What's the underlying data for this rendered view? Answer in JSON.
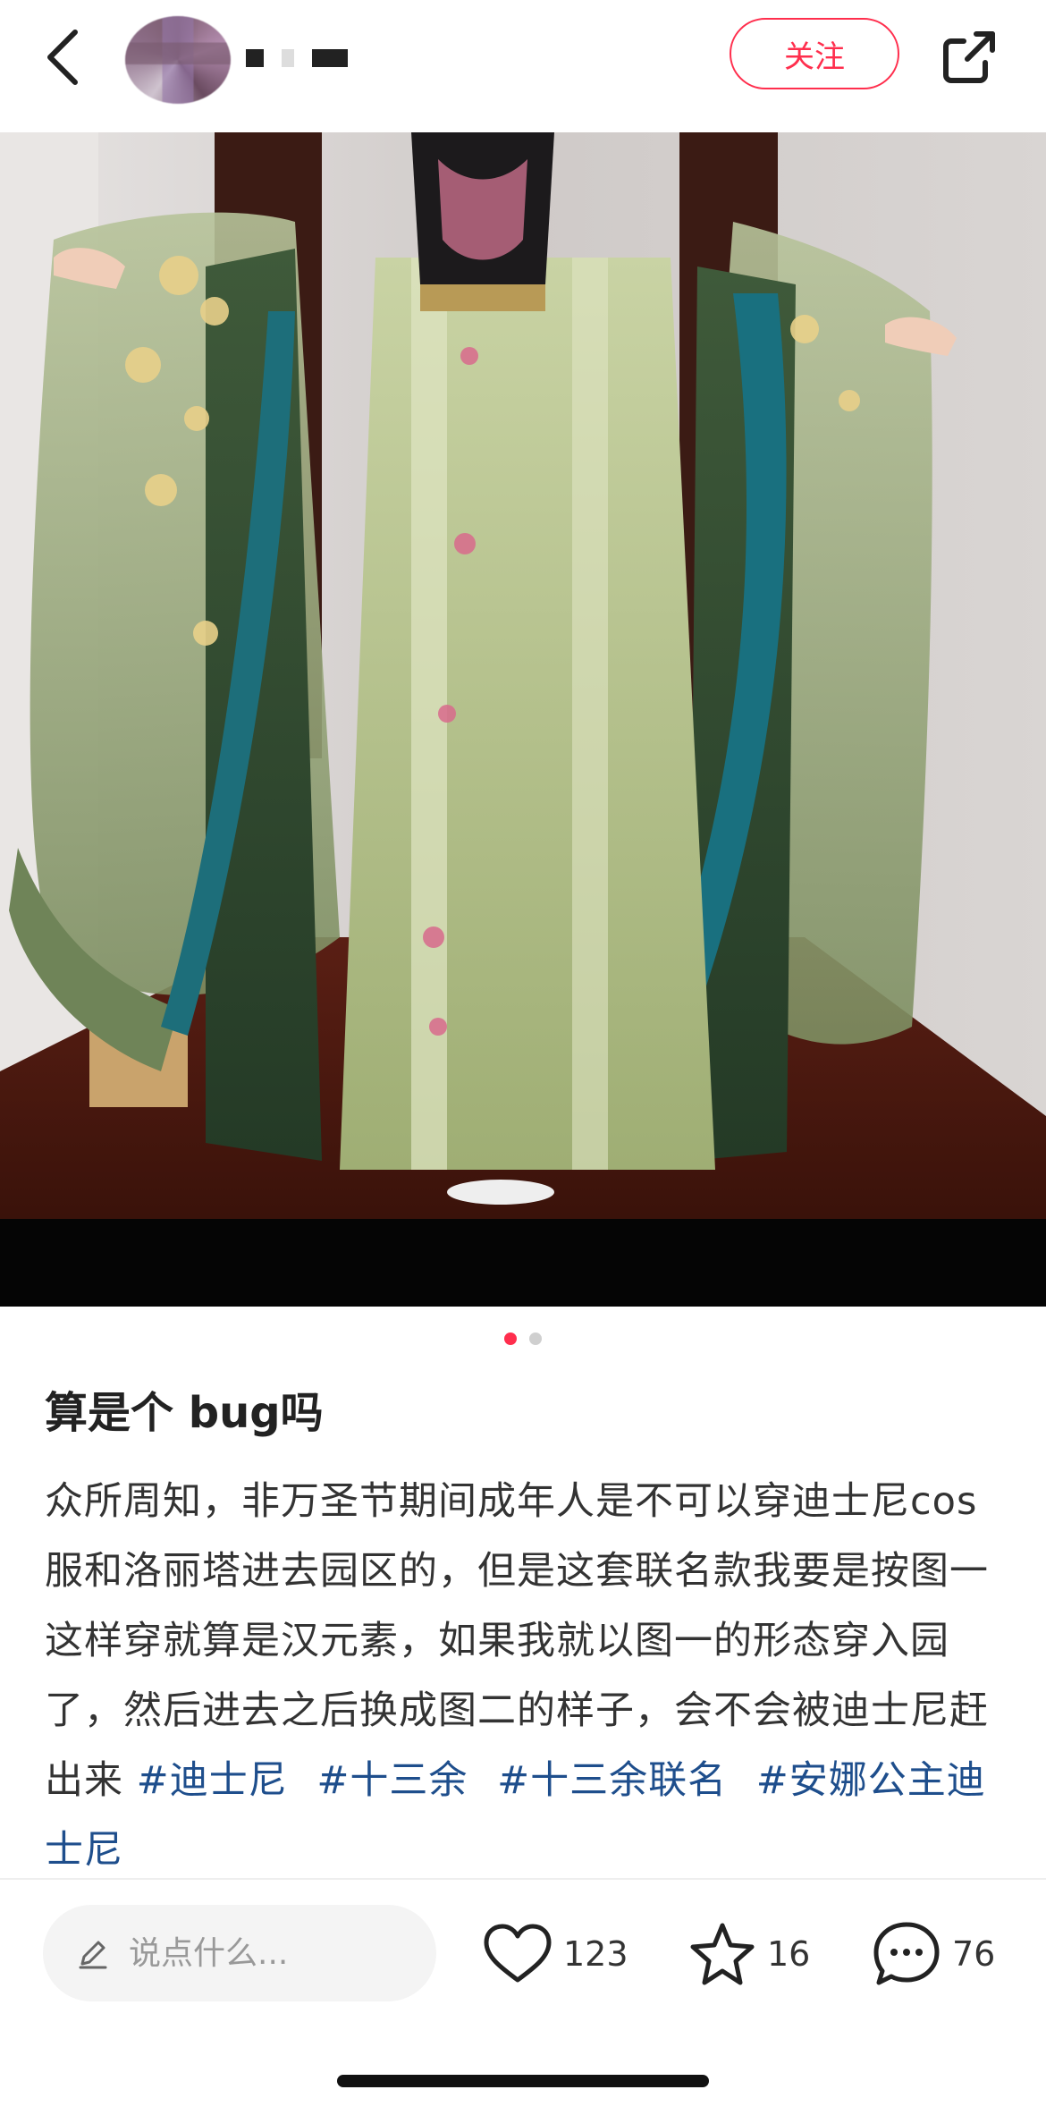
{
  "header": {
    "follow_label": "关注",
    "back_icon": "chevron-left-icon",
    "share_icon": "share-external-icon"
  },
  "carousel": {
    "total": 2,
    "active_index": 0
  },
  "post": {
    "title": "算是个 bug吗",
    "body": "众所周知，非万圣节期间成年人是不可以穿迪士尼cos服和洛丽塔进去园区的，但是这套联名款我要是按图一这样穿就算是汉元素，如果我就以图一的形态穿入园了，然后进去之后换成图二的样子，会不会被迪士尼赶出来",
    "tags": [
      "#迪士尼",
      "#十三余",
      "#十三余联名",
      "#安娜公主迪士尼"
    ]
  },
  "bottom_bar": {
    "comment_placeholder": "说点什么...",
    "likes": "123",
    "collects": "16",
    "comments": "76"
  },
  "colors": {
    "accent": "#ff2e4d",
    "tag": "#1e4e8c"
  }
}
